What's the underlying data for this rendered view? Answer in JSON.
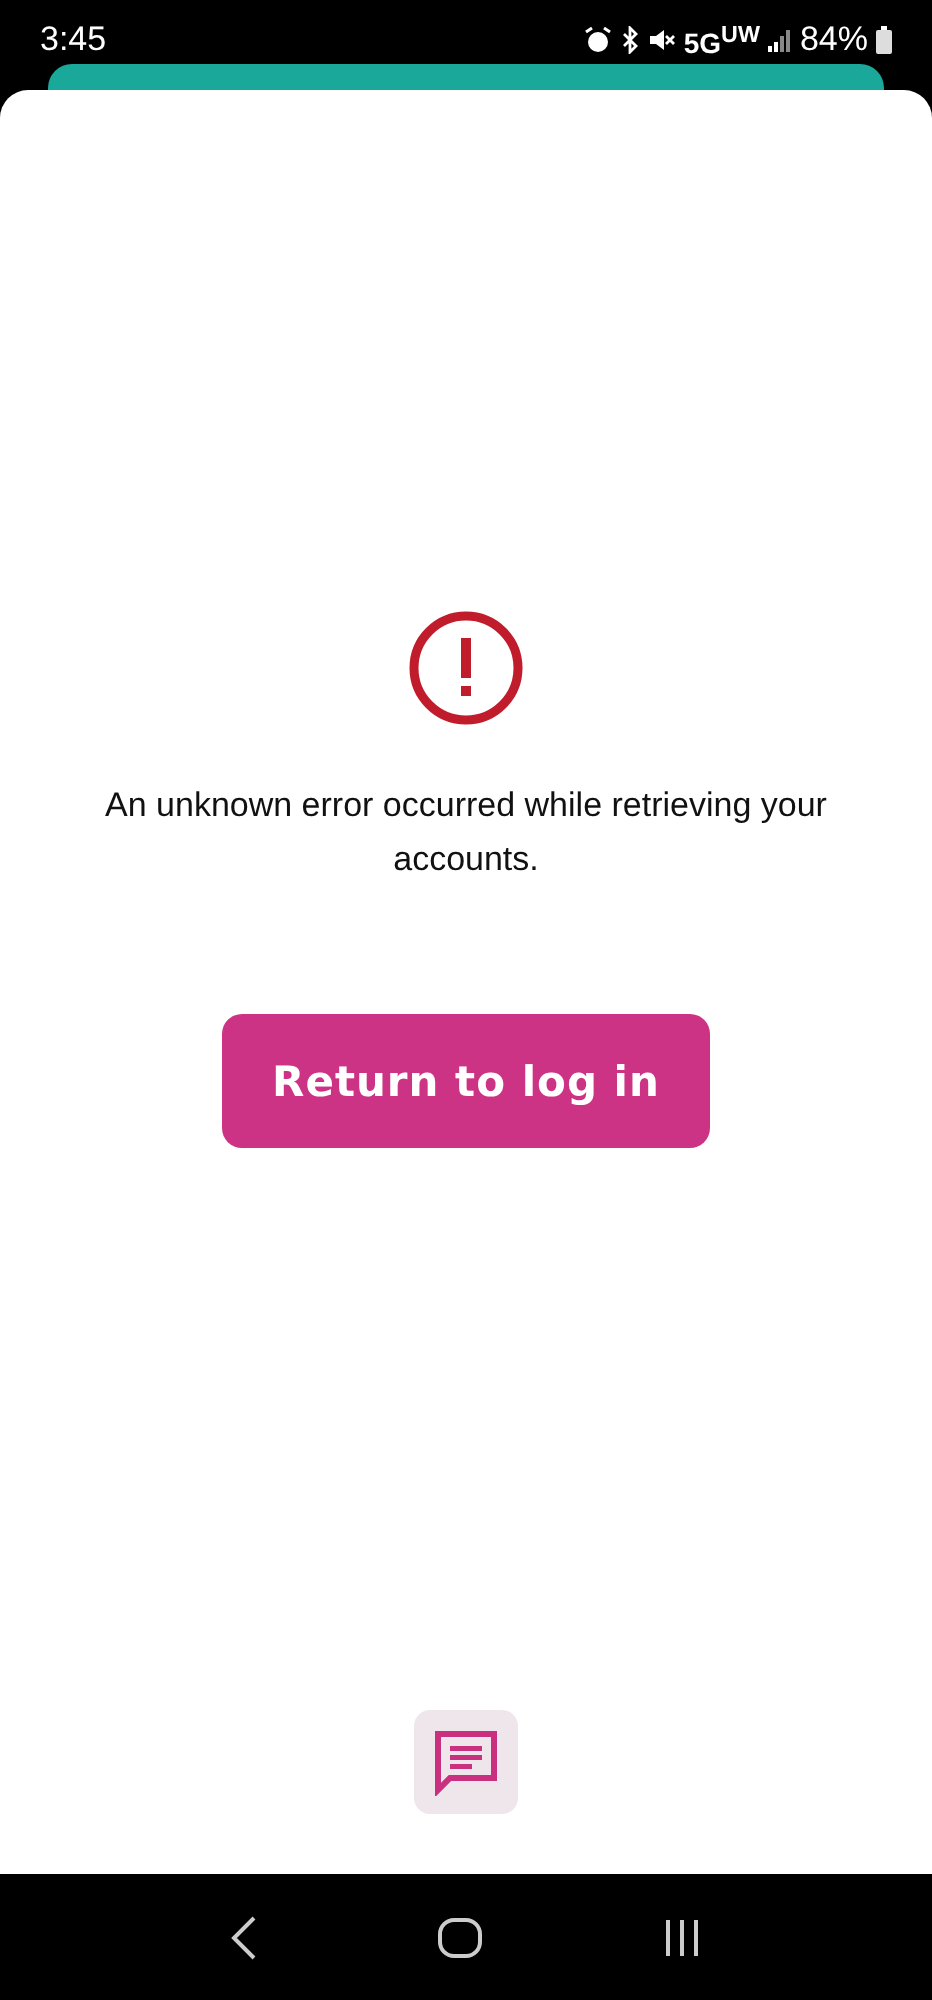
{
  "status_bar": {
    "time": "3:45",
    "network": "5G$^{UW}$",
    "battery": "84%"
  },
  "error": {
    "message": "An unknown error occurred while retrieving your accounts."
  },
  "button": {
    "label": "Return to log in"
  }
}
